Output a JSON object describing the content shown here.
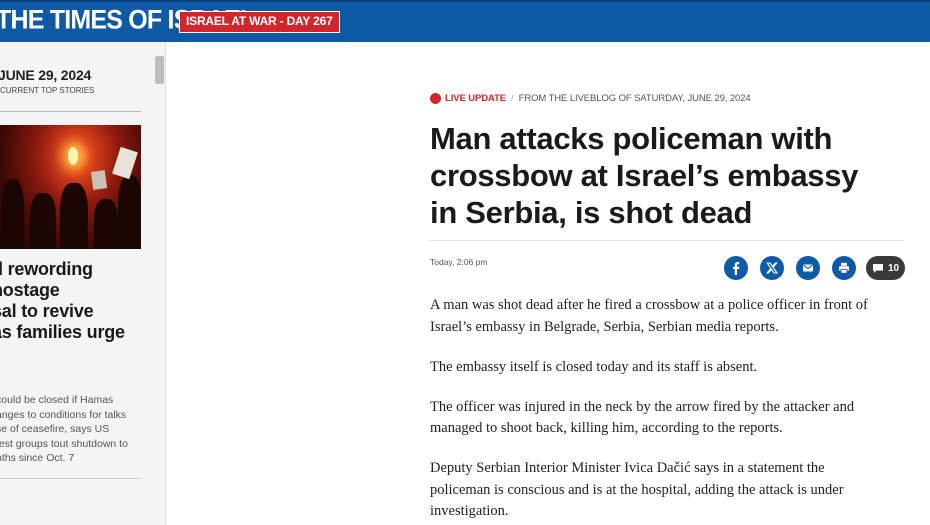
{
  "header": {
    "logo": "THE TIMES OF ISRAEL",
    "war_badge": "ISRAEL AT WAR - DAY 267",
    "colors": {
      "bar": "#0e5aa7",
      "badge": "#d0262c"
    }
  },
  "sidebar": {
    "date": "JUNE 29, 2024",
    "subtitle": "CURRENT TOP STORIES",
    "top_story": {
      "headline": "d rewording\nhostage\nsal to revive\nas families urge",
      "summary": " could be closed if Hamas\nanges to conditions for talks\nse of ceasefire, says US\ntest groups tout shutdown to\nnths since Oct. 7"
    }
  },
  "article": {
    "live_label": "LIVE UPDATE",
    "separator": "/",
    "source": "FROM THE LIVEBLOG OF SATURDAY, JUNE 29, 2024",
    "headline": "Man attacks policeman with\ncrossbow at Israel’s embassy\nin Serbia, is shot dead",
    "timestamp": "Today, 2:06 pm",
    "share_icons": [
      "facebook-icon",
      "x-twitter-icon",
      "email-icon",
      "print-icon"
    ],
    "comment_count": "10",
    "paragraphs": [
      "A man was shot dead after he fired a crossbow at a police officer in front of\nIsrael’s embassy in Belgrade, Serbia, Serbian media reports.",
      "The embassy itself is closed today and its staff is absent.",
      "The officer was injured in the neck by the arrow fired by the attacker and\nmanaged to shoot back, killing him, according to the reports.",
      "Deputy Serbian Interior Minister Ivica Dačić says in a statement the\npoliceman is conscious and is at the hospital, adding the attack is under\ninvestigation."
    ]
  }
}
